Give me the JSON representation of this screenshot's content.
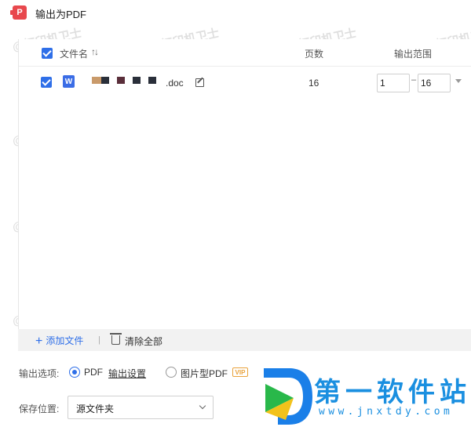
{
  "window": {
    "title": "输出为PDF",
    "icon": "pdf-app-icon"
  },
  "table": {
    "headers": {
      "filename": "文件名",
      "pages": "页数",
      "range": "输出范围"
    },
    "rows": [
      {
        "icon": "W",
        "name_suffix": ".doc",
        "pages": "16",
        "range_from": "1",
        "range_to": "16",
        "checked": true
      }
    ]
  },
  "toolbar": {
    "add_file": "添加文件",
    "separator": "|",
    "clear_all": "清除全部"
  },
  "output_options": {
    "label": "输出选项:",
    "pdf": "PDF",
    "settings_link": "输出设置",
    "image_pdf": "图片型PDF",
    "vip_badge": "VIP",
    "selected": "PDF"
  },
  "save_location": {
    "label": "保存位置:",
    "value": "源文件夹"
  },
  "watermark": {
    "text": "@打印机卫士"
  },
  "brand": {
    "name": "第一软件站",
    "url": "www.jnxtdy.com"
  },
  "colors": {
    "accent": "#2f6fe8",
    "pdf_red": "#e8484d",
    "word_blue": "#3b6de6",
    "vip": "#e9a23b",
    "brand_blue": "#1a8fe0"
  }
}
